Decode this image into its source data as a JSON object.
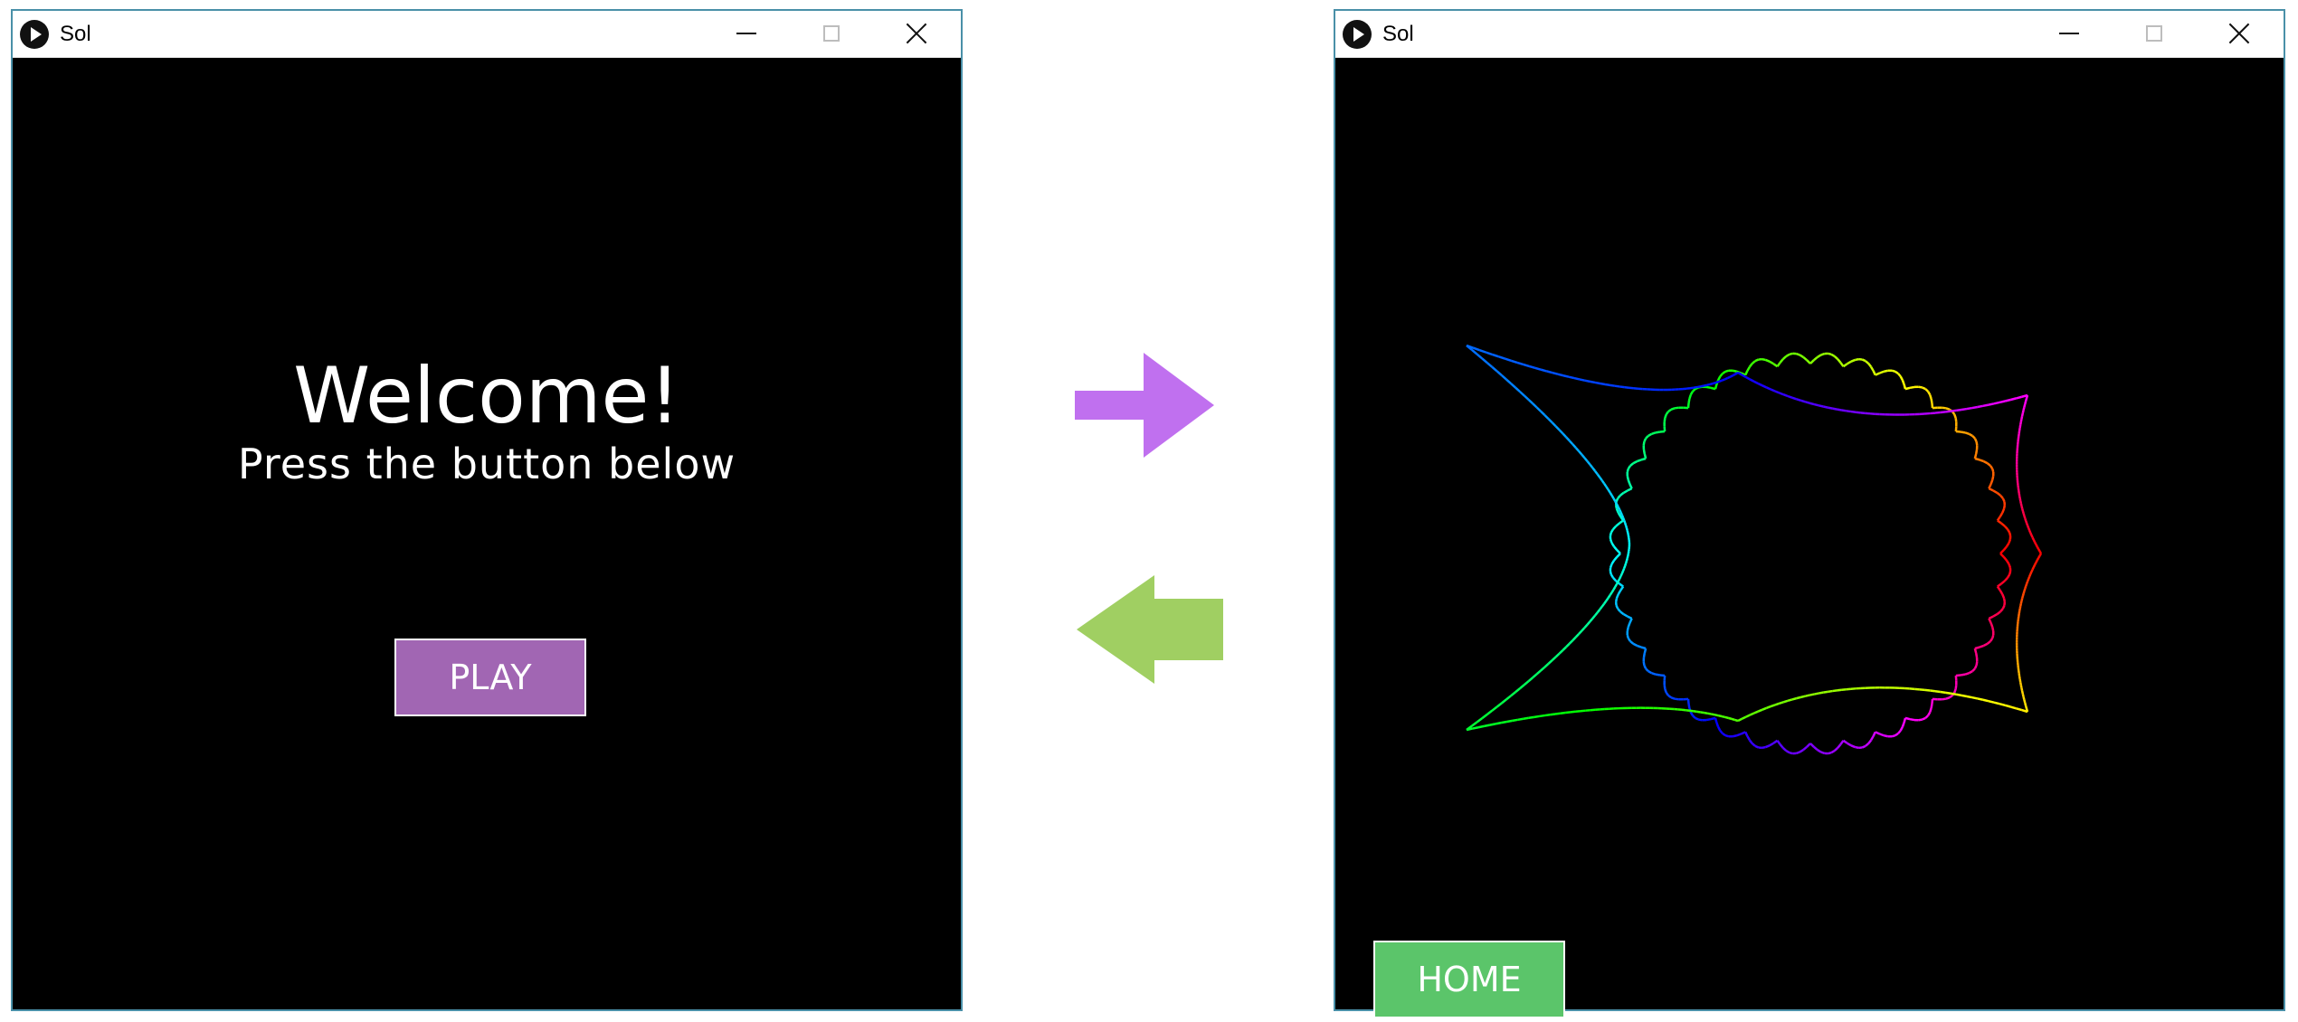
{
  "left_window": {
    "title": "Sol",
    "welcome_text": "Welcome!",
    "subtitle_text": "Press the button below",
    "play_label": "PLAY",
    "play_color": "#a166b3"
  },
  "right_window": {
    "title": "Sol",
    "home_label": "HOME",
    "home_color": "#5bc56a",
    "drawing": "rainbow-fractal-curve"
  },
  "arrows": {
    "forward": {
      "icon": "arrow-right-icon",
      "color": "#c070ef"
    },
    "back": {
      "icon": "arrow-left-icon",
      "color": "#a0cf62"
    }
  },
  "window_controls": {
    "minimize": "minimize-icon",
    "maximize": "maximize-icon",
    "close": "close-icon"
  }
}
